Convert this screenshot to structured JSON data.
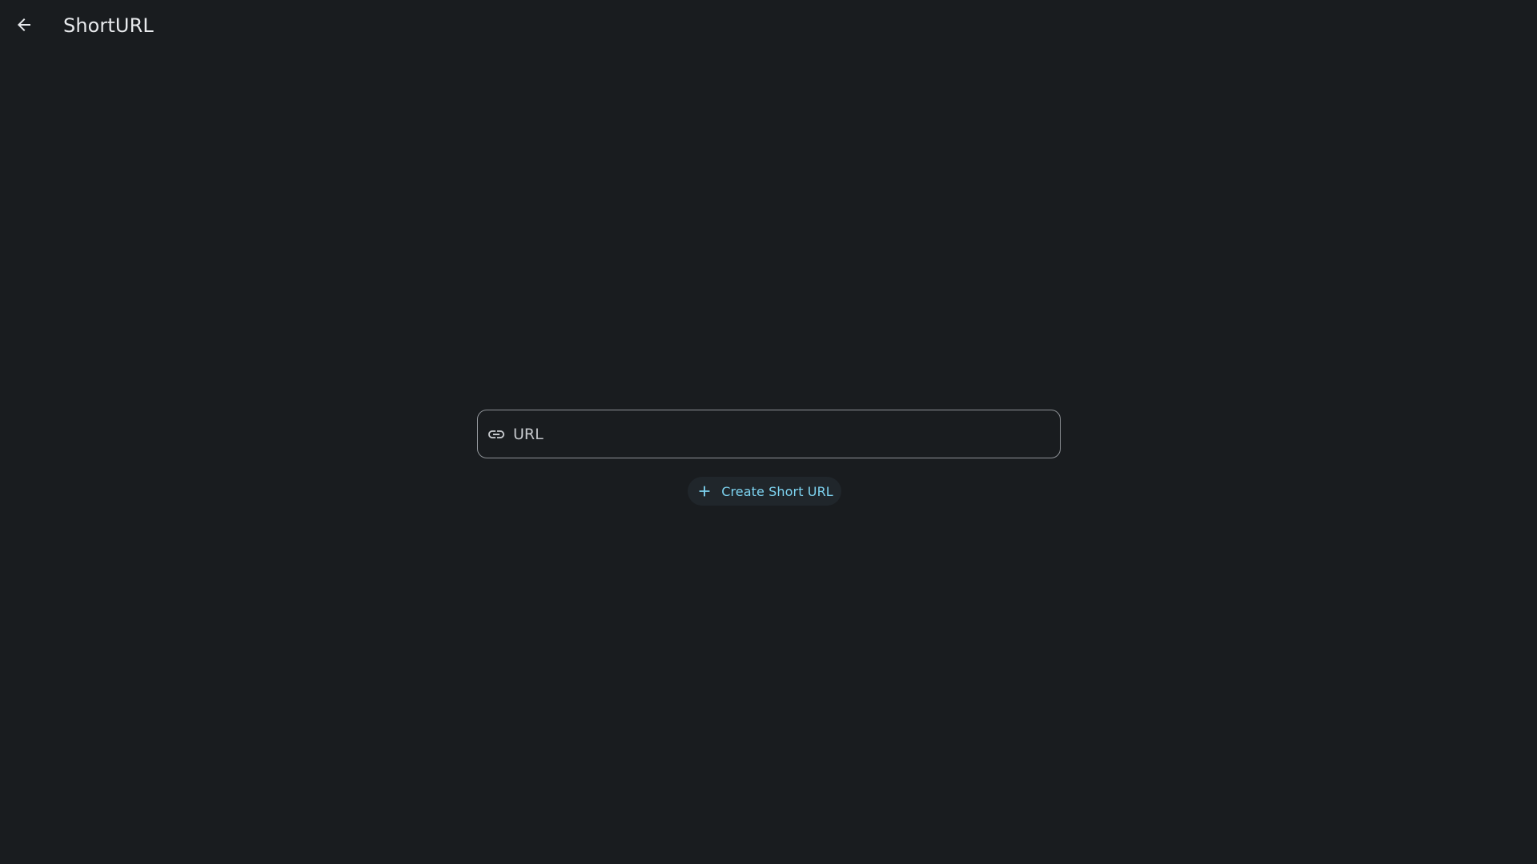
{
  "app_bar": {
    "title": "ShortURL",
    "back_icon": "arrow-back-icon"
  },
  "form": {
    "url_field": {
      "placeholder": "URL",
      "value": "",
      "icon": "link-icon"
    },
    "create_button": {
      "label": "Create Short URL",
      "icon": "plus-icon"
    }
  },
  "colors": {
    "background": "#191c1f",
    "accent": "#7dd3f0",
    "text": "#e8eaed",
    "outline": "#8e9297"
  }
}
